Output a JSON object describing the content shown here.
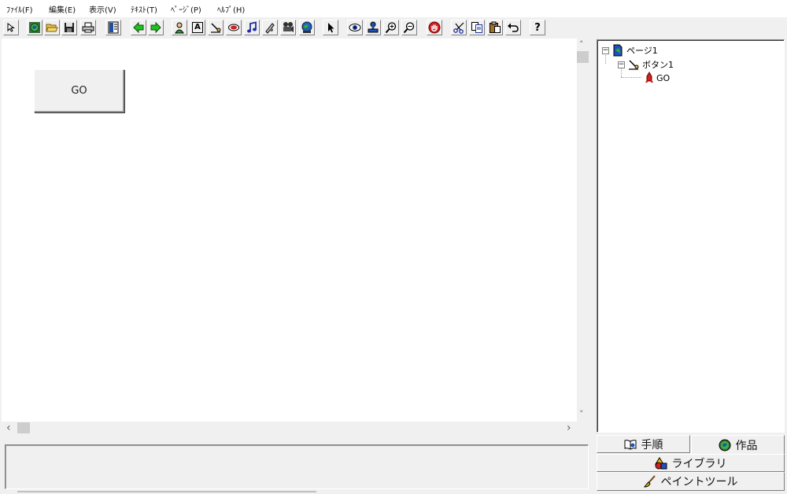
{
  "menu": [
    "ﾌｧｲﾙ(F)",
    "編集(E)",
    "表示(V)",
    "ﾃｷｽﾄ(T)",
    "ﾍﾟｰｼﾞ(P)",
    "ﾍﾙﾌﾟ(H)"
  ],
  "toolbar": {
    "text_tool_label": "A",
    "help_label": "?"
  },
  "canvas": {
    "go_button_label": "GO"
  },
  "tree": {
    "page": "ページ1",
    "button": "ボタン1",
    "action": "GO",
    "expander_symbol": "−"
  },
  "tabs": {
    "procedure": "手順",
    "work": "作品",
    "library": "ライブラリ",
    "paint": "ペイントツール"
  },
  "scroll": {
    "up": "˄",
    "down": "˅",
    "left": "‹",
    "right": "›"
  }
}
